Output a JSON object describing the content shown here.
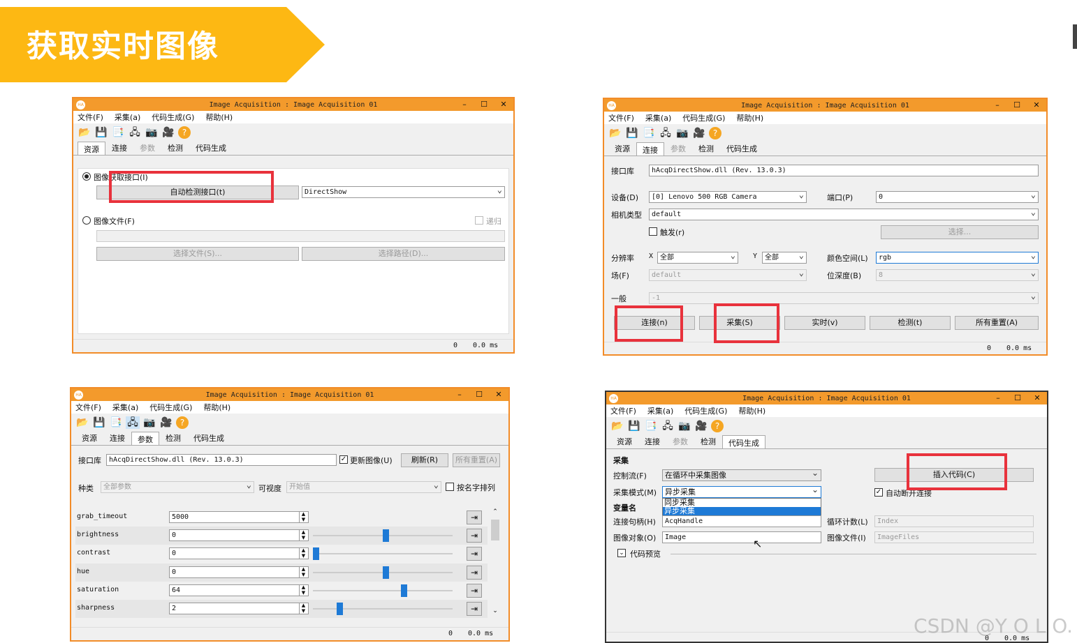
{
  "banner": {
    "title": "获取实时图像"
  },
  "common": {
    "window_title": "Image Acquisition : Image Acquisition 01",
    "menu": [
      "文件(F)",
      "采集(a)",
      "代码生成(G)",
      "帮助(H)"
    ],
    "tabs": [
      "资源",
      "连接",
      "参数",
      "检测",
      "代码生成"
    ],
    "status_count": "0",
    "status_time": "0.0 ms",
    "toolbar_icons": [
      "open-folder-icon",
      "save-icon",
      "document-icon",
      "network-icon",
      "camera-icon",
      "video-camera-icon",
      "help-icon"
    ]
  },
  "win1": {
    "radio_interface": "图像获取接口(I)",
    "autodetect_button": "自动检测接口(t)",
    "interface_select": "DirectShow",
    "radio_file": "图像文件(F)",
    "recursive_label": "递归",
    "select_file_button": "选择文件(S)...",
    "select_path_button": "选择路径(D)..."
  },
  "win2": {
    "library_label": "接口库",
    "library_value": "hAcqDirectShow.dll (Rev. 13.0.3)",
    "device_label": "设备(D)",
    "device_value": "[0] Lenovo 500 RGB Camera",
    "port_label": "端口(P)",
    "port_value": "0",
    "camera_type_label": "相机类型",
    "camera_type_value": "default",
    "trigger_label": "触发(r)",
    "select_button": "选择...",
    "resolution_label": "分辨率",
    "x_label": "X",
    "x_value": "全部",
    "y_label": "Y",
    "y_value": "全部",
    "colorspace_label": "颜色空间(L)",
    "colorspace_value": "rgb",
    "field_label": "场(F)",
    "field_value": "default",
    "bitdepth_label": "位深度(B)",
    "bitdepth_value": "8",
    "general_label": "一般",
    "general_value": "-1",
    "connect_button": "连接(n)",
    "grab_button": "采集(S)",
    "live_button": "实时(v)",
    "detect_button": "检测(t)",
    "reset_all_button": "所有重置(A)"
  },
  "win3": {
    "library_label": "接口库",
    "library_value": "hAcqDirectShow.dll (Rev. 13.0.3)",
    "update_image_label": "更新图像(U)",
    "refresh_button": "刷新(R)",
    "reset_all_button": "所有重置(A)",
    "category_label": "种类",
    "category_value": "全部参数",
    "visibility_label": "可视度",
    "visibility_value": "开始值",
    "sort_label": "按名字排列",
    "params": [
      {
        "name": "grab_timeout",
        "value": "5000",
        "level": null
      },
      {
        "name": "brightness",
        "value": "0",
        "level": 0.5
      },
      {
        "name": "contrast",
        "value": "0",
        "level": 0.0
      },
      {
        "name": "hue",
        "value": "0",
        "level": 0.5
      },
      {
        "name": "saturation",
        "value": "64",
        "level": 0.63
      },
      {
        "name": "sharpness",
        "value": "2",
        "level": 0.17
      }
    ]
  },
  "win4": {
    "section_grab": "采集",
    "control_flow_label": "控制流(F)",
    "control_flow_value": "在循环中采集图像",
    "insert_code_button": "插入代码(C)",
    "grab_mode_label": "采集模式(M)",
    "grab_mode_value": "异步采集",
    "grab_mode_options": [
      "同步采集",
      "异步采集"
    ],
    "auto_disconnect_label": "自动断开连接",
    "section_varname": "变量名",
    "handle_label": "连接句柄(H)",
    "handle_value": "AcqHandle",
    "loop_counter_label": "循环计数(L)",
    "loop_counter_value": "Index",
    "image_object_label": "图像对象(O)",
    "image_object_value": "Image",
    "image_files_label": "图像文件(I)",
    "image_files_value": "ImageFiles",
    "code_preview_label": "代码预览"
  },
  "watermark": "CSDN @Y O L O."
}
